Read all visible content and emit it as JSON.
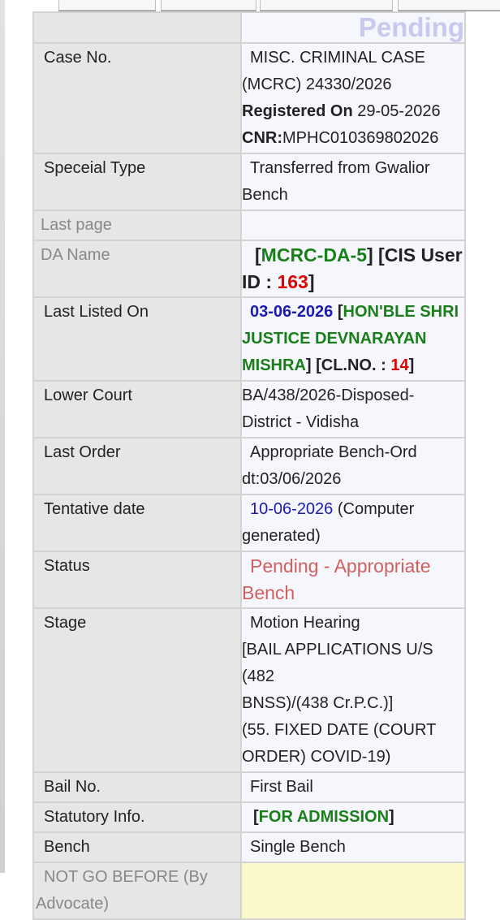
{
  "header": {
    "status_heading": "Pending"
  },
  "rows": {
    "case_no": {
      "label": "Case No.",
      "line1": "MISC. CRIMINAL CASE",
      "line2": "(MCRC) 24330/2026",
      "registered_label": "Registered On",
      "registered_value": " 29-05-2026",
      "cnr_label": "CNR:",
      "cnr_value": "MPHC010369802026"
    },
    "special_type": {
      "label": "Speceial Type",
      "line1": "Transferred from Gwalior",
      "line2": "Bench"
    },
    "last_page": {
      "label": "Last page",
      "value": ""
    },
    "da_name": {
      "label": "DA Name",
      "bracket_open": "[",
      "da_code": "MCRC-DA-5",
      "mid": "] [CIS User",
      "id_label": "ID : ",
      "id_value": "163",
      "bracket_close": "]"
    },
    "last_listed": {
      "label": "Last Listed On",
      "date": "03-06-2026",
      "open": " [",
      "judge_line1": "HON'BLE SHRI",
      "judge_line2": "JUSTICE DEVNARAYAN",
      "judge_line3": "MISHRA",
      "cl_text": "] [CL.NO. : ",
      "cl_no": "14",
      "close": "]"
    },
    "lower_court": {
      "label": "Lower Court",
      "line1": "BA/438/2026-Disposed-",
      "line2": "District - Vidisha"
    },
    "last_order": {
      "label": "Last Order",
      "line1": "Appropriate Bench-Ord",
      "line2": "dt:03/06/2026"
    },
    "tentative_date": {
      "label": "Tentative date",
      "date": "10-06-2026",
      "note1": " (Computer",
      "note2": "generated)"
    },
    "status": {
      "label": "Status",
      "line1": "Pending - Appropriate",
      "line2": "Bench"
    },
    "stage": {
      "label": "Stage",
      "line1": "Motion Hearing",
      "line2": "[BAIL APPLICATIONS U/S (482",
      "line3": "BNSS)/(438 Cr.P.C.)]",
      "line4": "(55. FIXED DATE (COURT",
      "line5": "ORDER) COVID-19)"
    },
    "bail_no": {
      "label": "Bail No.",
      "value": "First Bail"
    },
    "statutory_info": {
      "label": "Statutory Info.",
      "open": "[",
      "value": "FOR ADMISSION",
      "close": "]"
    },
    "bench": {
      "label": "Bench",
      "value": "Single Bench"
    },
    "not_go_before": {
      "label_line1": "NOT GO BEFORE (By",
      "label_line2": "Advocate)",
      "value": ""
    }
  },
  "colors": {
    "label_bg": "#e6e6e6",
    "value_bg": "#f5f7fc",
    "green": "#1a7f1a",
    "red": "#e00000",
    "blue": "#1b1bb0",
    "status_red": "#d06060",
    "pending_heading": "#c9c9ef",
    "yellow": "#fbf8cc"
  }
}
